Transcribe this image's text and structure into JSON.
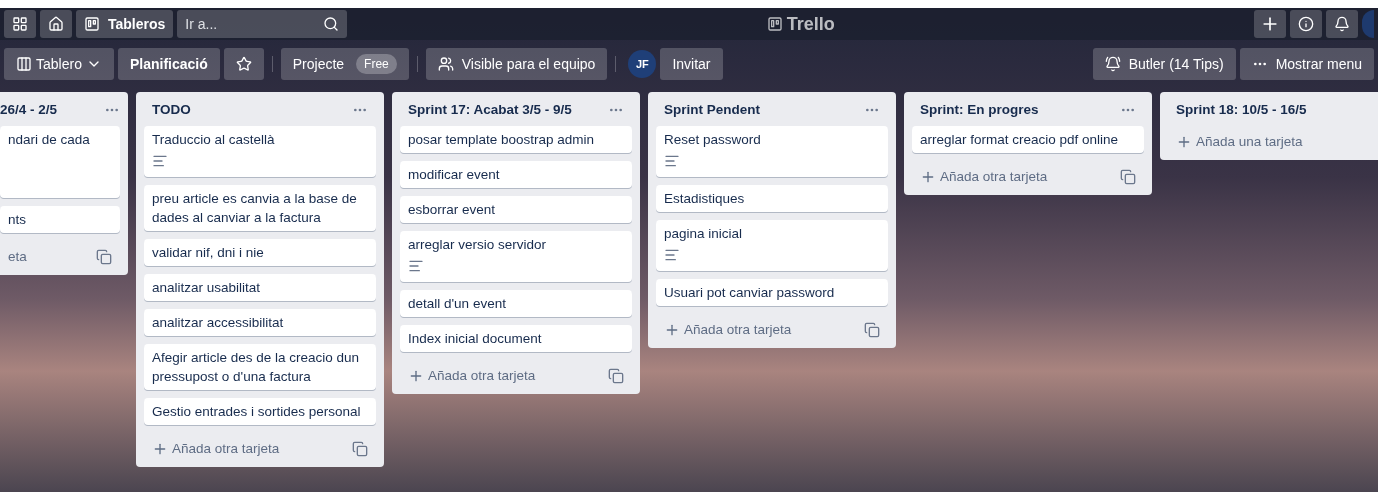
{
  "top_bar": {
    "boards_button": "Tableros",
    "search": {
      "placeholder": "Ir a..."
    },
    "logo": "Trello"
  },
  "board_header": {
    "view_button": "Tablero",
    "title": "Planificació",
    "starred": false,
    "team_button": "Projecte",
    "team_badge": "Free",
    "visibility_button": "Visible para el equipo",
    "member_initials": "JF",
    "invite_button": "Invitar",
    "butler_button": "Butler (14 Tips)",
    "menu_button": "Mostrar menu"
  },
  "lists": [
    {
      "title": "26/4 - 2/5",
      "clipped": true,
      "has_menu": true,
      "add_label": "eta",
      "has_template_button": true,
      "cards": [
        {
          "text": "ndari de cada",
          "has_description": false,
          "tall": true
        },
        {
          "text": "nts",
          "has_description": false,
          "tall": false
        }
      ]
    },
    {
      "title": "TODO",
      "clipped": false,
      "has_menu": true,
      "add_label": "Añada otra tarjeta",
      "has_template_button": true,
      "cards": [
        {
          "text": "Traduccio al castellà",
          "has_description": true,
          "tall": false
        },
        {
          "text": "preu article es canvia a la base de dades al canviar a la factura",
          "has_description": false,
          "tall": false
        },
        {
          "text": "validar nif, dni i nie",
          "has_description": false,
          "tall": false
        },
        {
          "text": "analitzar usabilitat",
          "has_description": false,
          "tall": false
        },
        {
          "text": "analitzar accessibilitat",
          "has_description": false,
          "tall": false
        },
        {
          "text": "Afegir article des de la creacio dun pressupost o d'una factura",
          "has_description": false,
          "tall": false
        },
        {
          "text": "Gestio entrades i sortides personal",
          "has_description": false,
          "tall": false
        }
      ]
    },
    {
      "title": "Sprint 17: Acabat 3/5 - 9/5",
      "clipped": false,
      "has_menu": true,
      "add_label": "Añada otra tarjeta",
      "has_template_button": true,
      "cards": [
        {
          "text": "posar template boostrap admin",
          "has_description": false,
          "tall": false
        },
        {
          "text": "modificar event",
          "has_description": false,
          "tall": false
        },
        {
          "text": "esborrar event",
          "has_description": false,
          "tall": false
        },
        {
          "text": "arreglar versio servidor",
          "has_description": true,
          "tall": false
        },
        {
          "text": "detall d'un event",
          "has_description": false,
          "tall": false
        },
        {
          "text": "Index inicial document",
          "has_description": false,
          "tall": false
        }
      ]
    },
    {
      "title": "Sprint Pendent",
      "clipped": false,
      "has_menu": true,
      "add_label": "Añada otra tarjeta",
      "has_template_button": true,
      "cards": [
        {
          "text": "Reset password",
          "has_description": true,
          "tall": false
        },
        {
          "text": "Estadistiques",
          "has_description": false,
          "tall": false
        },
        {
          "text": "pagina inicial",
          "has_description": true,
          "tall": false
        },
        {
          "text": "Usuari pot canviar password",
          "has_description": false,
          "tall": false
        }
      ]
    },
    {
      "title": "Sprint: En progres",
      "clipped": false,
      "has_menu": true,
      "add_label": "Añada otra tarjeta",
      "has_template_button": true,
      "cards": [
        {
          "text": "arreglar format creacio pdf online",
          "has_description": false,
          "tall": false
        }
      ]
    },
    {
      "title": "Sprint 18: 10/5 - 16/5",
      "clipped": false,
      "add_label": "Añada una tarjeta",
      "has_template_button": false
    }
  ]
}
